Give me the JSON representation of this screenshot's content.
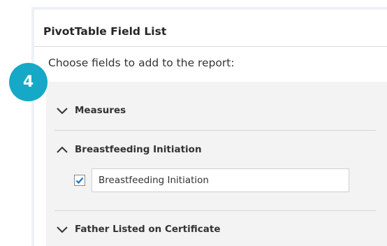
{
  "panel": {
    "title": "PivotTable Field List",
    "instruction": "Choose fields to add to the report:"
  },
  "sections": [
    {
      "label": "Measures",
      "state": "collapsed",
      "icon": "chevron-down-icon"
    },
    {
      "label": "Breastfeeding Initiation",
      "state": "expanded",
      "icon": "chevron-up-icon"
    },
    {
      "label": "Father Listed on Certificate",
      "state": "collapsed",
      "icon": "chevron-down-icon"
    }
  ],
  "fields": [
    {
      "label": "Breastfeeding Initiation",
      "checked": true
    }
  ],
  "badge": {
    "step": "4"
  },
  "colors": {
    "badge": "#15a9c7",
    "checkmark": "#1a73c9",
    "field_area": "#f3f3f3",
    "panel_border": "#eef1f5"
  }
}
